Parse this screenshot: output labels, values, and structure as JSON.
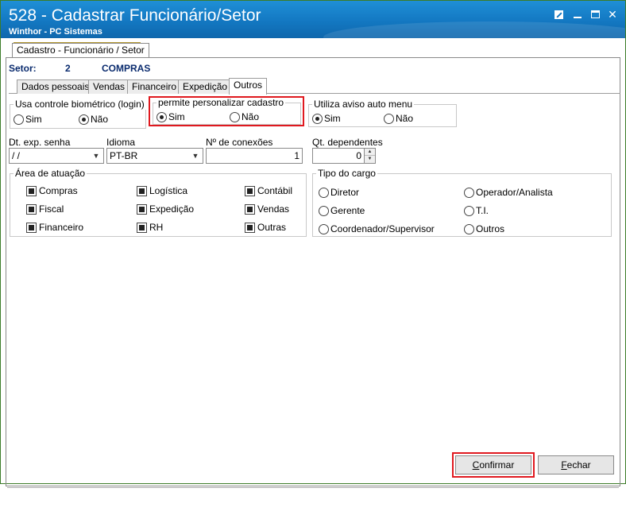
{
  "window": {
    "title": "528 - Cadastrar Funcionário/Setor",
    "subtitle": "Winthor - PC Sistemas",
    "title_bar_color": "#1378c2"
  },
  "outer_tab": {
    "label": "Cadastro - Funcionário / Setor"
  },
  "setor": {
    "label": "Setor:",
    "code": "2",
    "name": "COMPRAS"
  },
  "tabs": [
    {
      "label": "Dados pessoais",
      "active": false
    },
    {
      "label": "Vendas",
      "active": false
    },
    {
      "label": "Financeiro",
      "active": false
    },
    {
      "label": "Expedição",
      "active": false
    },
    {
      "label": "Outros",
      "active": true
    }
  ],
  "biometrico": {
    "legend": "Usa controle biométrico (login)",
    "options": [
      {
        "label": "Sim",
        "selected": false
      },
      {
        "label": "Não",
        "selected": true
      }
    ]
  },
  "personalizar": {
    "legend": "permite personalizar cadastro",
    "options": [
      {
        "label": "Sim",
        "selected": true
      },
      {
        "label": "Não",
        "selected": false
      }
    ]
  },
  "aviso_menu": {
    "legend": "Utiliza aviso auto menu",
    "options": [
      {
        "label": "Sim",
        "selected": true
      },
      {
        "label": "Não",
        "selected": false
      }
    ]
  },
  "fields": {
    "dt_exp_senha": {
      "label": "Dt. exp. senha",
      "value": " / /"
    },
    "idioma": {
      "label": "Idioma",
      "value": "PT-BR"
    },
    "num_conexoes": {
      "label": "Nº de conexões",
      "value": "1"
    },
    "qt_dependentes": {
      "label": "Qt. dependentes",
      "value": "0"
    }
  },
  "area_atuacao": {
    "legend": "Área de atuação",
    "items": [
      {
        "label": "Compras",
        "checked": true
      },
      {
        "label": "Logística",
        "checked": true
      },
      {
        "label": "Contábil",
        "checked": true
      },
      {
        "label": "Fiscal",
        "checked": true
      },
      {
        "label": "Expedição",
        "checked": true
      },
      {
        "label": "Vendas",
        "checked": true
      },
      {
        "label": "Financeiro",
        "checked": true
      },
      {
        "label": "RH",
        "checked": true
      },
      {
        "label": "Outras",
        "checked": true
      }
    ]
  },
  "tipo_cargo": {
    "legend": "Tipo do cargo",
    "items": [
      {
        "label": "Diretor",
        "selected": false
      },
      {
        "label": "Operador/Analista",
        "selected": false
      },
      {
        "label": "Gerente",
        "selected": false
      },
      {
        "label": "T.I.",
        "selected": false
      },
      {
        "label": "Coordenador/Supervisor",
        "selected": false
      },
      {
        "label": "Outros",
        "selected": false
      }
    ]
  },
  "buttons": {
    "confirmar": {
      "label": "onfirmar",
      "hotkey": "C"
    },
    "fechar": {
      "label": "echar",
      "hotkey": "F"
    }
  },
  "highlight_color": "#e0191f"
}
